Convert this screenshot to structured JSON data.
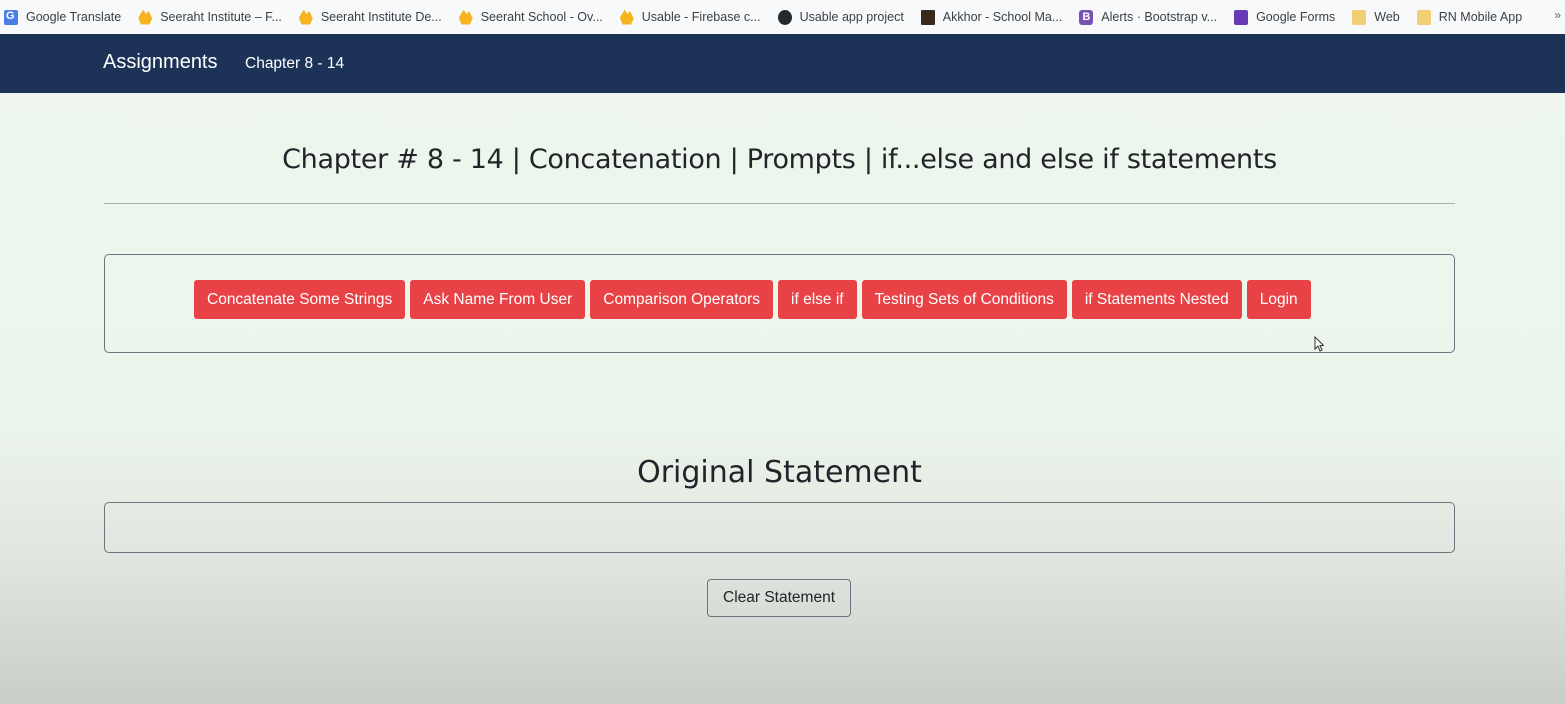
{
  "bookmarks": [
    {
      "label": "Google Translate",
      "icon": "google-translate-icon"
    },
    {
      "label": "Seeraht Institute – F...",
      "icon": "firebase-icon"
    },
    {
      "label": "Seeraht Institute De...",
      "icon": "firebase-icon"
    },
    {
      "label": "Seeraht School - Ov...",
      "icon": "firebase-icon"
    },
    {
      "label": "Usable - Firebase c...",
      "icon": "firebase-icon"
    },
    {
      "label": "Usable app project",
      "icon": "github-icon"
    },
    {
      "label": "Akkhor - School Ma...",
      "icon": "akkhor-icon"
    },
    {
      "label": "Alerts · Bootstrap v...",
      "icon": "bootstrap-icon"
    },
    {
      "label": "Google Forms",
      "icon": "google-forms-icon"
    },
    {
      "label": "Web",
      "icon": "folder-icon"
    },
    {
      "label": "RN Mobile App",
      "icon": "folder-icon"
    }
  ],
  "navbar": {
    "brand": "Assignments",
    "link": "Chapter 8 - 14",
    "background": "#1c3357"
  },
  "main": {
    "title": "Chapter # 8 - 14 | Concatenation | Prompts | if...else and else if statements",
    "buttons": [
      "Concatenate Some Strings",
      "Ask Name From User",
      "Comparison Operators",
      "if else if",
      "Testing Sets of Conditions",
      "if Statements Nested",
      "Login"
    ],
    "button_color": "#e84246",
    "section_title": "Original Statement",
    "statement_value": "",
    "clear_button": "Clear Statement"
  }
}
